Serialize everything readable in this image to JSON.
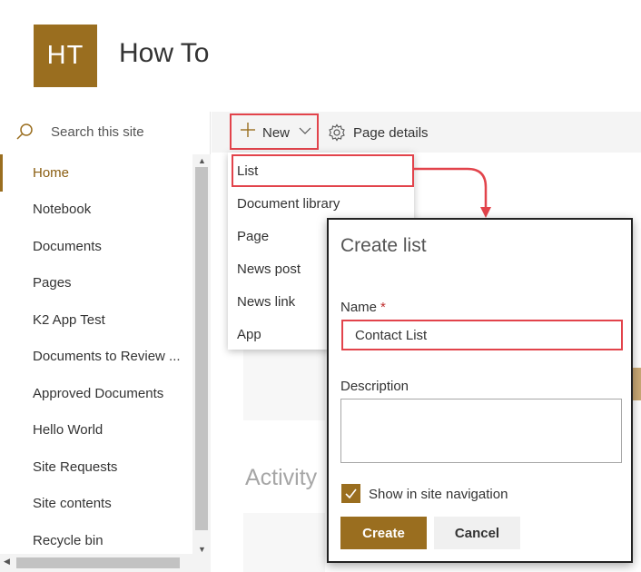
{
  "site": {
    "logo_initials": "HT",
    "title": "How To",
    "accent": "#9a6e1f",
    "highlight": "#e2434b"
  },
  "search": {
    "placeholder": "Search this site",
    "icon": "search-icon"
  },
  "nav": {
    "items": [
      {
        "label": "Home"
      },
      {
        "label": "Notebook"
      },
      {
        "label": "Documents"
      },
      {
        "label": "Pages"
      },
      {
        "label": "K2 App Test"
      },
      {
        "label": "Documents to Review ..."
      },
      {
        "label": "Approved Documents"
      },
      {
        "label": "Hello World"
      },
      {
        "label": "Site Requests"
      },
      {
        "label": "Site contents"
      },
      {
        "label": "Recycle bin"
      }
    ]
  },
  "command_bar": {
    "new_label": "New",
    "page_details_label": "Page details"
  },
  "new_menu": {
    "items": [
      {
        "label": "List"
      },
      {
        "label": "Document library"
      },
      {
        "label": "Page"
      },
      {
        "label": "News post"
      },
      {
        "label": "News link"
      },
      {
        "label": "App"
      }
    ]
  },
  "background": {
    "activity_heading": "Activity"
  },
  "create_list": {
    "title": "Create list",
    "name_label": "Name",
    "required_marker": "*",
    "name_value": "Contact List",
    "description_label": "Description",
    "description_value": "",
    "show_in_nav_label": "Show in site navigation",
    "show_in_nav_checked": true,
    "create_label": "Create",
    "cancel_label": "Cancel"
  }
}
